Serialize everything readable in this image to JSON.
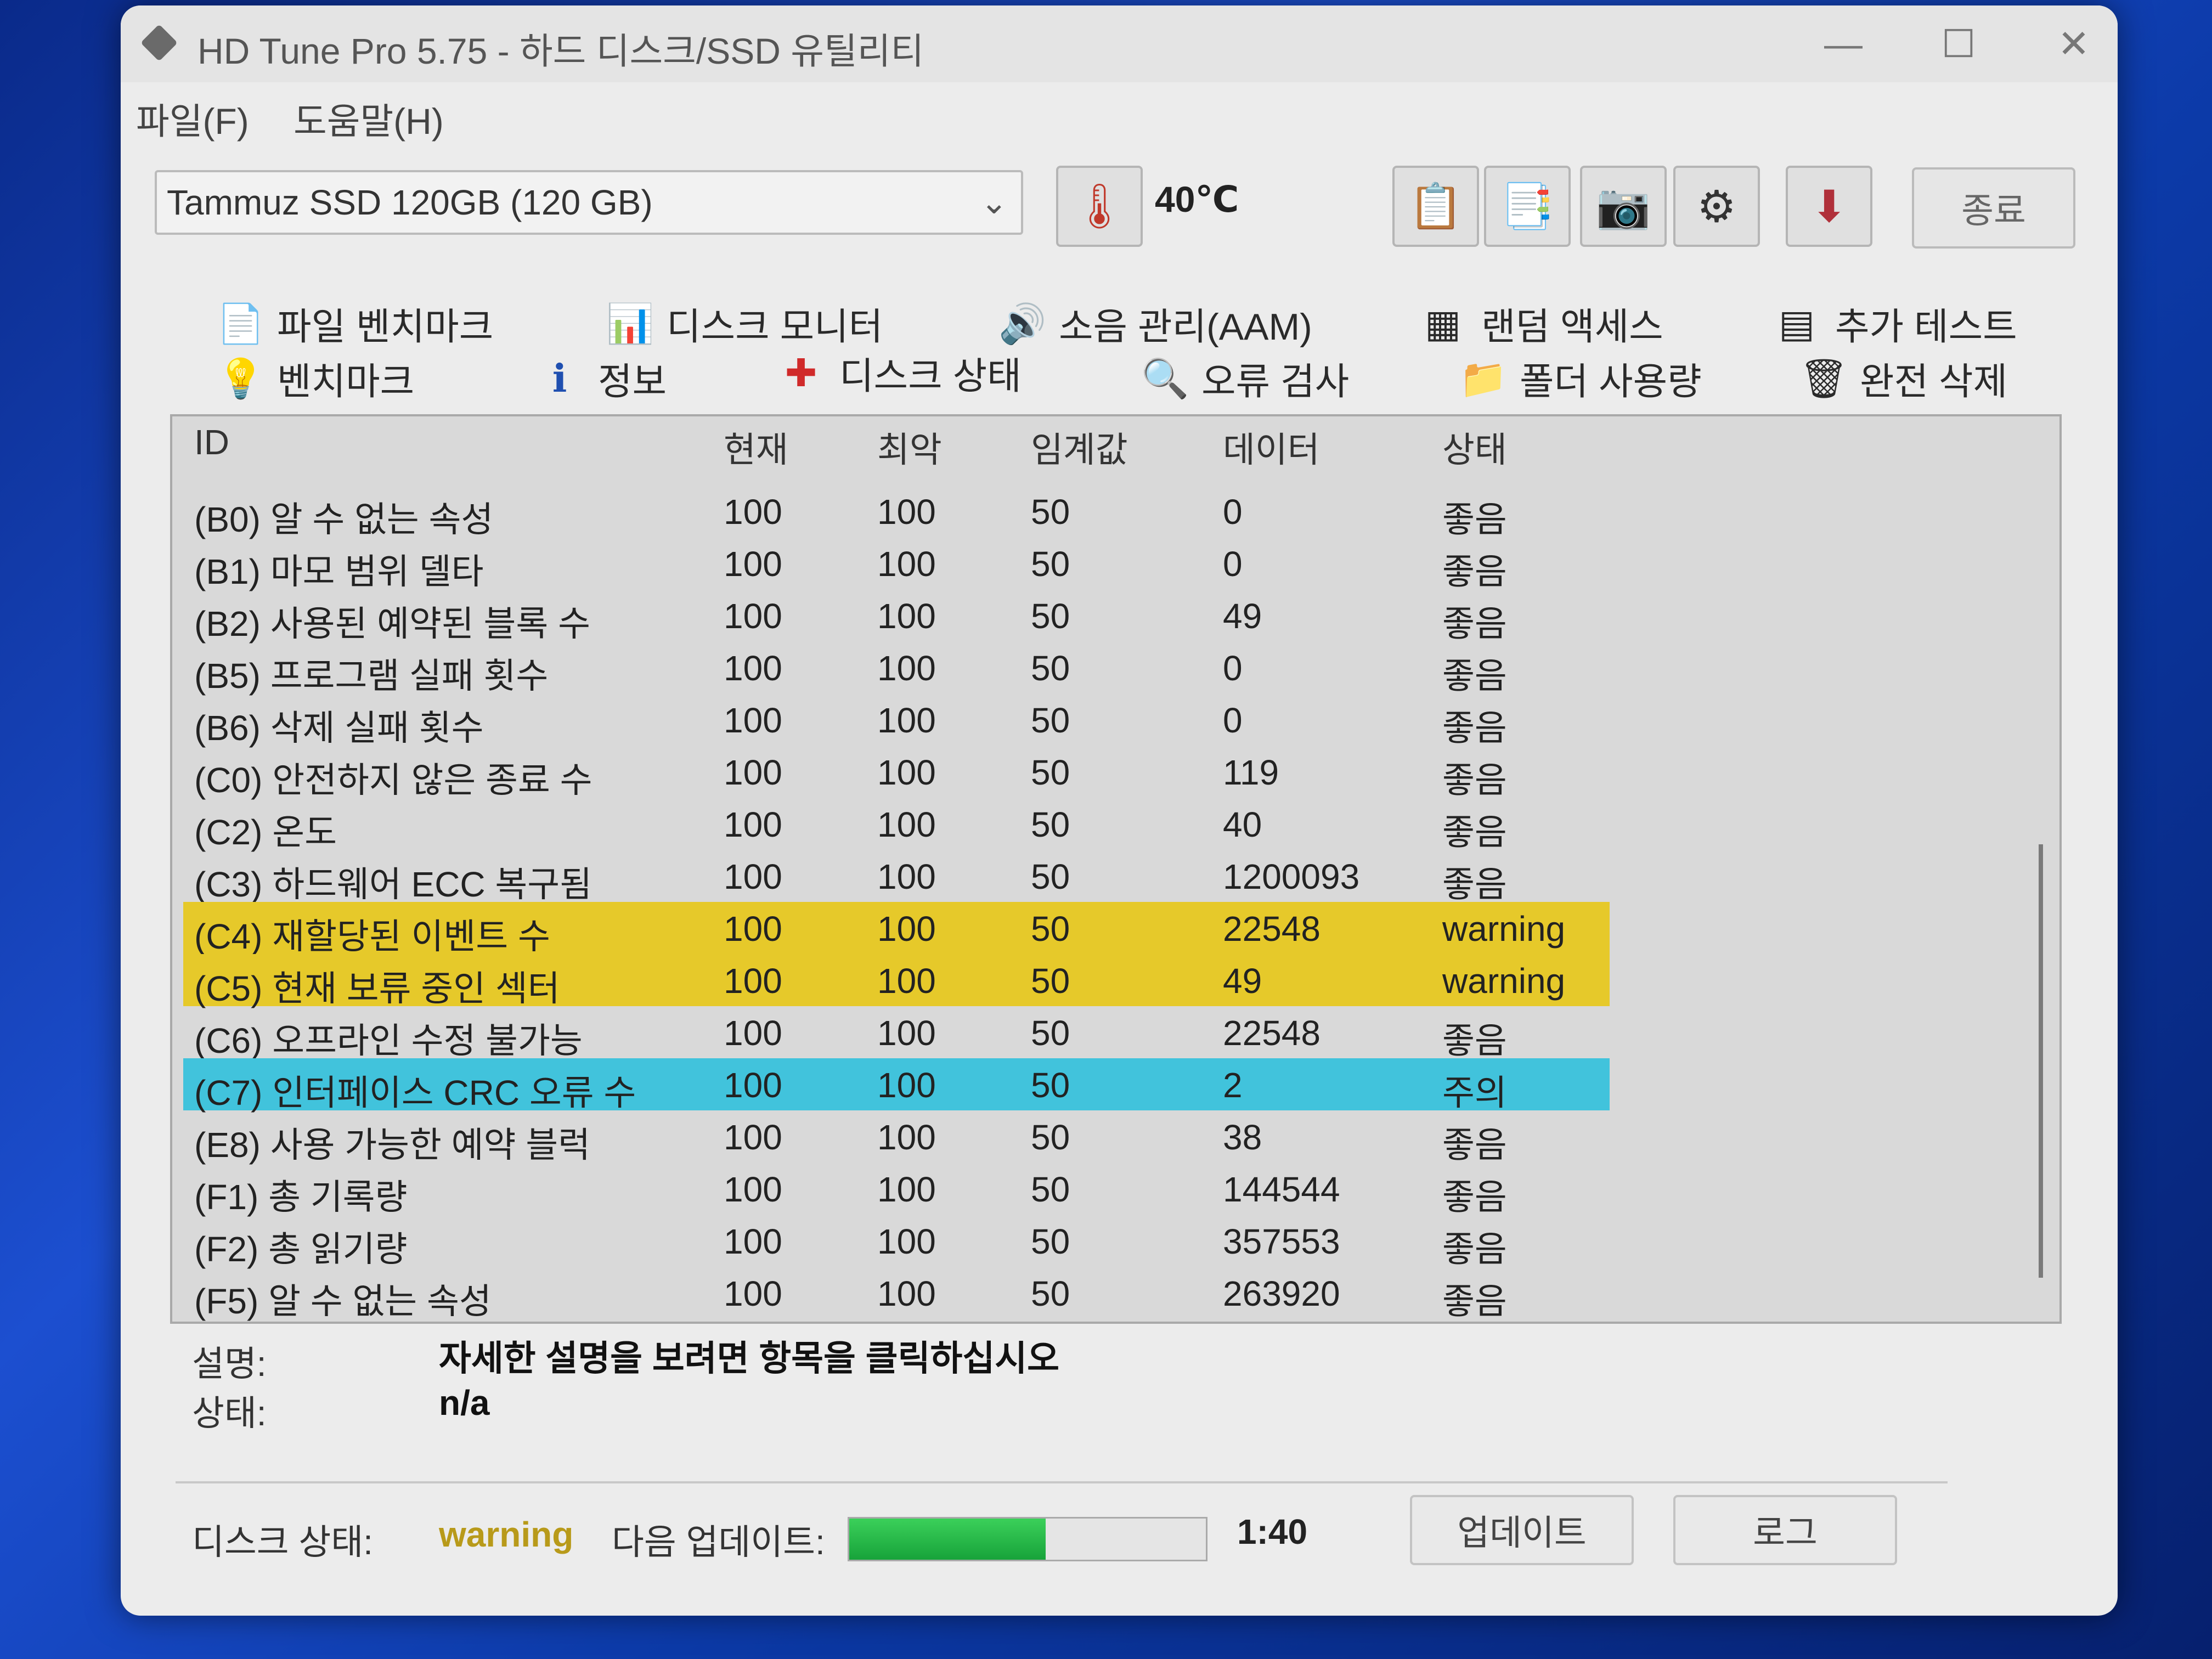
{
  "window": {
    "title": "HD Tune Pro 5.75 - 하드 디스크/SSD 유틸리티",
    "min": "—",
    "max": "☐",
    "close": "✕"
  },
  "menu": {
    "file": "파일(F)",
    "help": "도움말(H)"
  },
  "toolbar": {
    "drive": "Tammuz SSD  120GB (120 GB)",
    "temperature": "40℃",
    "exit_label": "종료"
  },
  "tabs": {
    "row1": [
      "파일 벤치마크",
      "디스크 모니터",
      "소음 관리(AAM)",
      "랜덤 액세스",
      "추가 테스트"
    ],
    "row2": [
      "벤치마크",
      "정보",
      "디스크 상태",
      "오류 검사",
      "폴더 사용량",
      "완전 삭제"
    ]
  },
  "table": {
    "headers": [
      "ID",
      "현재",
      "최악",
      "임계값",
      "데이터",
      "상태"
    ],
    "rows": [
      {
        "id": "(B0) 알 수 없는 속성",
        "cur": "100",
        "worst": "100",
        "thr": "50",
        "data": "0",
        "status": "좋음",
        "hl": ""
      },
      {
        "id": "(B1) 마모 범위 델타",
        "cur": "100",
        "worst": "100",
        "thr": "50",
        "data": "0",
        "status": "좋음",
        "hl": ""
      },
      {
        "id": "(B2) 사용된 예약된 블록 수",
        "cur": "100",
        "worst": "100",
        "thr": "50",
        "data": "49",
        "status": "좋음",
        "hl": ""
      },
      {
        "id": "(B5) 프로그램 실패 횟수",
        "cur": "100",
        "worst": "100",
        "thr": "50",
        "data": "0",
        "status": "좋음",
        "hl": ""
      },
      {
        "id": "(B6) 삭제 실패 횟수",
        "cur": "100",
        "worst": "100",
        "thr": "50",
        "data": "0",
        "status": "좋음",
        "hl": ""
      },
      {
        "id": "(C0) 안전하지 않은 종료 수",
        "cur": "100",
        "worst": "100",
        "thr": "50",
        "data": "119",
        "status": "좋음",
        "hl": ""
      },
      {
        "id": "(C2) 온도",
        "cur": "100",
        "worst": "100",
        "thr": "50",
        "data": "40",
        "status": "좋음",
        "hl": ""
      },
      {
        "id": "(C3) 하드웨어 ECC 복구됨",
        "cur": "100",
        "worst": "100",
        "thr": "50",
        "data": "1200093",
        "status": "좋음",
        "hl": ""
      },
      {
        "id": "(C4) 재할당된 이벤트 수",
        "cur": "100",
        "worst": "100",
        "thr": "50",
        "data": "22548",
        "status": "warning",
        "hl": "warn"
      },
      {
        "id": "(C5) 현재 보류 중인 섹터",
        "cur": "100",
        "worst": "100",
        "thr": "50",
        "data": "49",
        "status": "warning",
        "hl": "warn"
      },
      {
        "id": "(C6) 오프라인 수정 불가능",
        "cur": "100",
        "worst": "100",
        "thr": "50",
        "data": "22548",
        "status": "좋음",
        "hl": ""
      },
      {
        "id": "(C7) 인터페이스 CRC 오류 수",
        "cur": "100",
        "worst": "100",
        "thr": "50",
        "data": "2",
        "status": "주의",
        "hl": "caution"
      },
      {
        "id": "(E8) 사용 가능한 예약 블럭",
        "cur": "100",
        "worst": "100",
        "thr": "50",
        "data": "38",
        "status": "좋음",
        "hl": ""
      },
      {
        "id": "(F1) 총 기록량",
        "cur": "100",
        "worst": "100",
        "thr": "50",
        "data": "144544",
        "status": "좋음",
        "hl": ""
      },
      {
        "id": "(F2) 총 읽기량",
        "cur": "100",
        "worst": "100",
        "thr": "50",
        "data": "357553",
        "status": "좋음",
        "hl": ""
      },
      {
        "id": "(F5) 알 수 없는 속성",
        "cur": "100",
        "worst": "100",
        "thr": "50",
        "data": "263920",
        "status": "좋음",
        "hl": ""
      }
    ]
  },
  "description": {
    "desc_label": "설명:",
    "desc_value": "자세한 설명을 보려면 항목을 클릭하십시오",
    "state_label": "상태:",
    "state_value": "n/a"
  },
  "status": {
    "disk_label": "디스크 상태:",
    "disk_value": "warning",
    "next_label": "다음 업데이트:",
    "progress": 0.55,
    "time": "1:40",
    "update_button": "업데이트",
    "log_button": "로그"
  },
  "colors": {
    "warning_row": "#e6c92a",
    "caution_row": "#41c3dc",
    "progress": "#1fb23f"
  }
}
